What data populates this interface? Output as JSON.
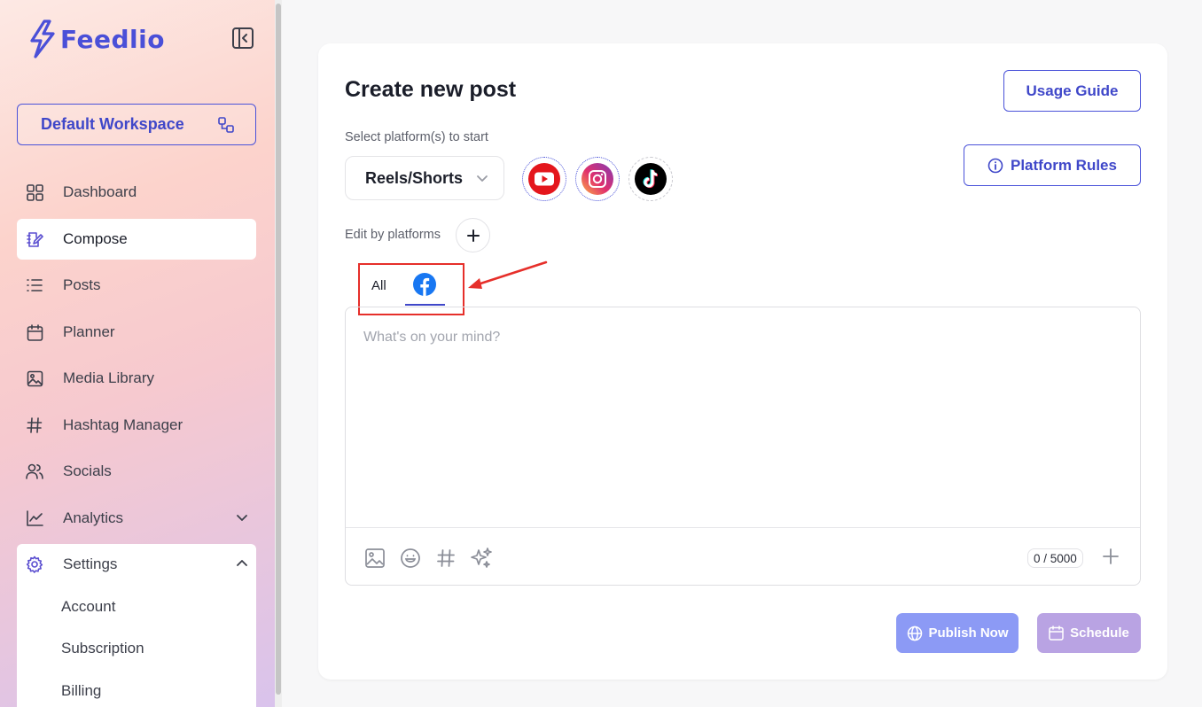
{
  "app": {
    "name": "Feedlio",
    "brand_color": "#4a4fd8"
  },
  "sidebar": {
    "workspace": "Default Workspace",
    "items": [
      {
        "label": "Dashboard",
        "icon": "dashboard-icon"
      },
      {
        "label": "Compose",
        "icon": "compose-icon",
        "active": true
      },
      {
        "label": "Posts",
        "icon": "list-icon"
      },
      {
        "label": "Planner",
        "icon": "calendar-icon"
      },
      {
        "label": "Media Library",
        "icon": "image-icon"
      },
      {
        "label": "Hashtag Manager",
        "icon": "hashtag-icon"
      },
      {
        "label": "Socials",
        "icon": "users-icon"
      },
      {
        "label": "Analytics",
        "icon": "chart-icon"
      },
      {
        "label": "Settings",
        "icon": "gear-icon"
      }
    ],
    "settings_subitems": [
      "Account",
      "Subscription",
      "Billing"
    ]
  },
  "main": {
    "title": "Create new post",
    "usage_guide": "Usage Guide",
    "platform_rules": "Platform Rules",
    "select_label": "Select platform(s) to start",
    "post_type": "Reels/Shorts",
    "platforms": [
      "youtube-icon",
      "instagram-icon",
      "tiktok-icon"
    ],
    "edit_label": "Edit by platforms",
    "tabs": {
      "all": "All",
      "facebook": "facebook-icon"
    },
    "editor": {
      "placeholder": "What's on your mind?",
      "counter": "0 / 5000"
    },
    "publish_now": "Publish Now",
    "schedule": "Schedule"
  },
  "colors": {
    "accent": "#3f47c9",
    "publish_button": "#8c9af5",
    "schedule_button": "#b9a3e3",
    "highlight": "#e62f2a"
  }
}
